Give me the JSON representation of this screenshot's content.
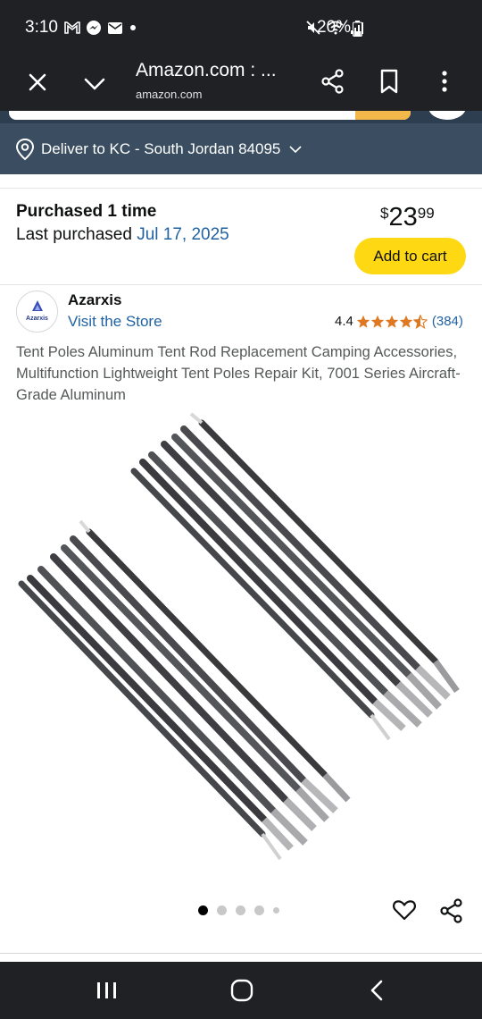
{
  "status_bar": {
    "time": "3:10",
    "battery": "20%",
    "left_icons": [
      "gmail-icon",
      "messenger-icon",
      "mail-icon",
      "dot-icon"
    ],
    "right_icons": [
      "mute-icon",
      "wifi-icon",
      "signal-icon",
      "battery-icon"
    ]
  },
  "browser": {
    "title": "Amazon.com : ...",
    "url": "amazon.com",
    "icons": [
      "close-icon",
      "chevron-down-icon",
      "share-icon",
      "bookmark-icon",
      "more-icon"
    ]
  },
  "deliver": {
    "text": "Deliver to KC - South Jordan 84095"
  },
  "purchase": {
    "title": "Purchased 1 time",
    "last_label": "Last purchased",
    "last_date": "Jul 17, 2025",
    "price_symbol": "$",
    "price_whole": "23",
    "price_fraction": "99",
    "add_to_cart": "Add to cart"
  },
  "brand": {
    "name": "Azarxis",
    "logo_text": "Azarxis",
    "visit_store": "Visit the Store",
    "rating": "4.4",
    "stars": 4.5,
    "review_count": "(384)"
  },
  "product": {
    "title": "Tent Poles Aluminum Tent Rod Replacement Camping Accessories, Multifunction Lightweight Tent Poles Repair Kit, 7001 Series Aircraft-Grade Aluminum"
  },
  "carousel": {
    "current": 1,
    "total": 5
  },
  "colors": {
    "dark_bar": "#1f2125",
    "deliver_bar": "#3b4e61",
    "link": "#2162a1",
    "cart_button": "#ffd814",
    "star": "#de7921"
  }
}
